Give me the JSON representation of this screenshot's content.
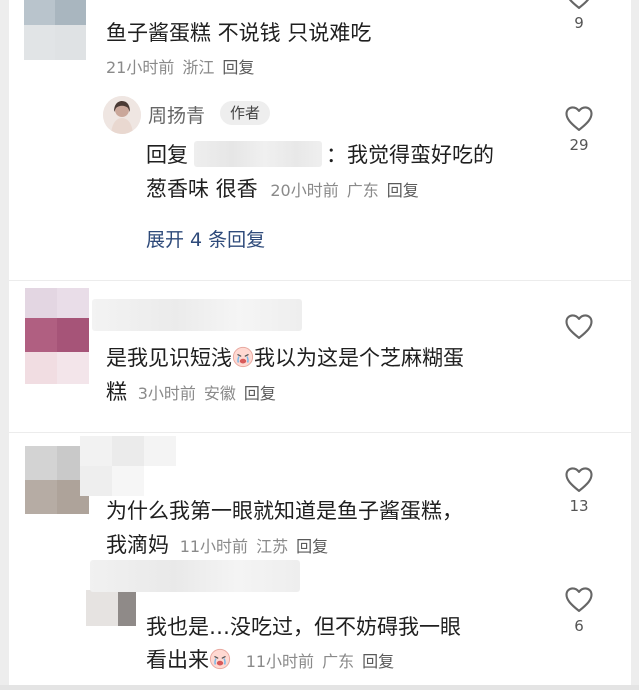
{
  "comments": [
    {
      "text": "鱼子酱蛋糕 不说钱 只说难吃",
      "time": "21小时前",
      "location": "浙江",
      "reply_label": "回复",
      "likes": "9"
    },
    {
      "author": "周扬青",
      "author_tag": "作者",
      "reply_prefix": "回复",
      "reply_sep": "：",
      "text_line1": "我觉得蛮好吃的",
      "text_line2": "葱香味 很香",
      "time": "20小时前",
      "location": "广东",
      "reply_label": "回复",
      "likes": "29",
      "expand_label": "展开 4 条回复"
    },
    {
      "text_before_emoji": "是我见识短浅",
      "text_after_emoji": "我以为这是个芝麻糊蛋",
      "text_line2": "糕",
      "time": "3小时前",
      "location": "安徽",
      "reply_label": "回复",
      "likes": ""
    },
    {
      "text_line1": "为什么我第一眼就知道是鱼子酱蛋糕，",
      "text_line2": "我滴妈",
      "time": "11小时前",
      "location": "江苏",
      "reply_label": "回复",
      "likes": "13"
    },
    {
      "text_line1": "我也是…没吃过，但不妨碍我一眼",
      "text_line2_before_emoji": "看出来",
      "time": "11小时前",
      "location": "广东",
      "reply_label": "回复",
      "likes": "6"
    }
  ],
  "colors": {
    "text": "#1f1f1f",
    "meta": "#8a8a8a",
    "expand": "#2e4a7a",
    "tag_bg": "#eeeeee"
  },
  "icons": {
    "like": "heart-outline-icon",
    "emoji": "crying-face-emoji-icon"
  }
}
